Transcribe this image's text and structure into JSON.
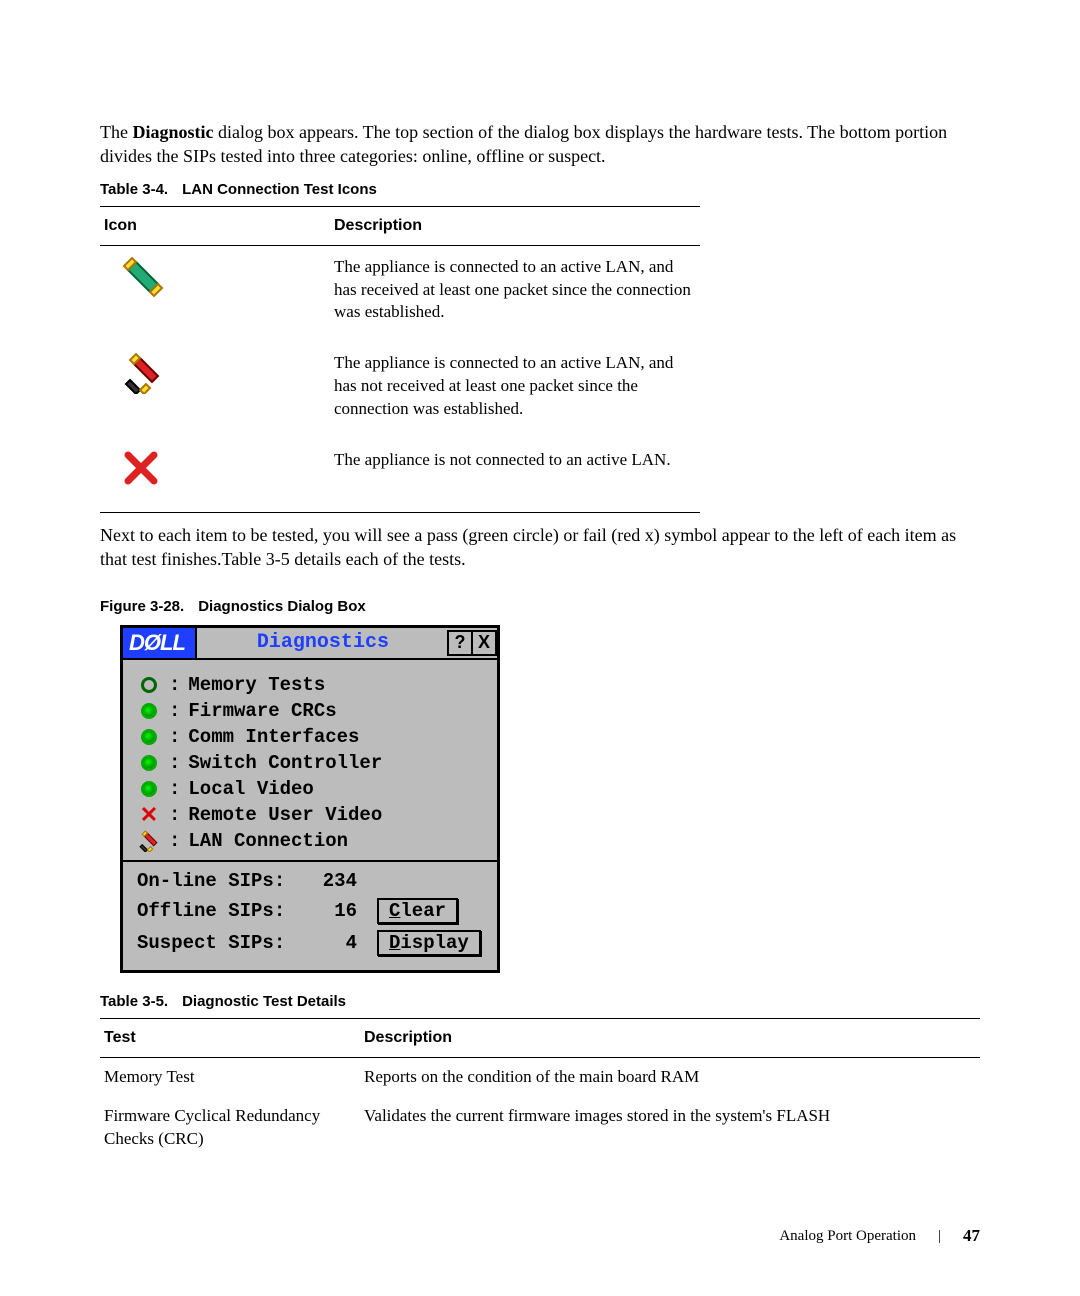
{
  "intro": {
    "p1a": "The ",
    "p1b": "Diagnostic",
    "p1c": " dialog box appears. The top section of the dialog box displays the hardware tests. The bottom portion divides the SIPs tested into three categories: online, offline or suspect."
  },
  "table34": {
    "caption_num": "Table 3-4.",
    "caption_txt": "LAN Connection Test Icons",
    "col1": "Icon",
    "col2": "Description",
    "rows": [
      "The appliance is connected to an active LAN, and has received at least one packet since the connection was established.",
      "The appliance is connected to an active LAN, and has not received at least one packet since the connection was established.",
      "The appliance is not connected to an active LAN."
    ]
  },
  "mid_para": "Next to each item to be tested, you will see a pass (green circle) or fail (red x) symbol appear to the left of each item as that test finishes.Table 3-5 details each of the tests.",
  "fig328": {
    "caption_num": "Figure 3-28.",
    "caption_txt": "Diagnostics Dialog Box"
  },
  "dialog": {
    "logo": "DØLL",
    "title": "Diagnostics",
    "help": "?",
    "close": "X",
    "tests": [
      {
        "status": "run",
        "label": "Memory Tests"
      },
      {
        "status": "pass",
        "label": "Firmware CRCs"
      },
      {
        "status": "pass",
        "label": "Comm Interfaces"
      },
      {
        "status": "pass",
        "label": "Switch Controller"
      },
      {
        "status": "pass",
        "label": "Local Video"
      },
      {
        "status": "fail",
        "label": "Remote User Video"
      },
      {
        "status": "lan",
        "label": "LAN Connection"
      }
    ],
    "stats": {
      "online_label": "On-line SIPs:",
      "online_val": "234",
      "offline_label": "Offline SIPs:",
      "offline_val": "16",
      "suspect_label": "Suspect SIPs:",
      "suspect_val": "4"
    },
    "btn_clear_u": "C",
    "btn_clear_r": "lear",
    "btn_display_u": "D",
    "btn_display_r": "isplay"
  },
  "table35": {
    "caption_num": "Table 3-5.",
    "caption_txt": "Diagnostic Test Details",
    "col1": "Test",
    "col2": "Description",
    "rows": [
      {
        "c1": "Memory Test",
        "c2": "Reports on the condition of the main board RAM"
      },
      {
        "c1": "Firmware Cyclical Redundancy Checks (CRC)",
        "c2": "Validates the current firmware images stored in the system's FLASH"
      }
    ]
  },
  "footer": {
    "section": "Analog Port Operation",
    "page": "47"
  }
}
